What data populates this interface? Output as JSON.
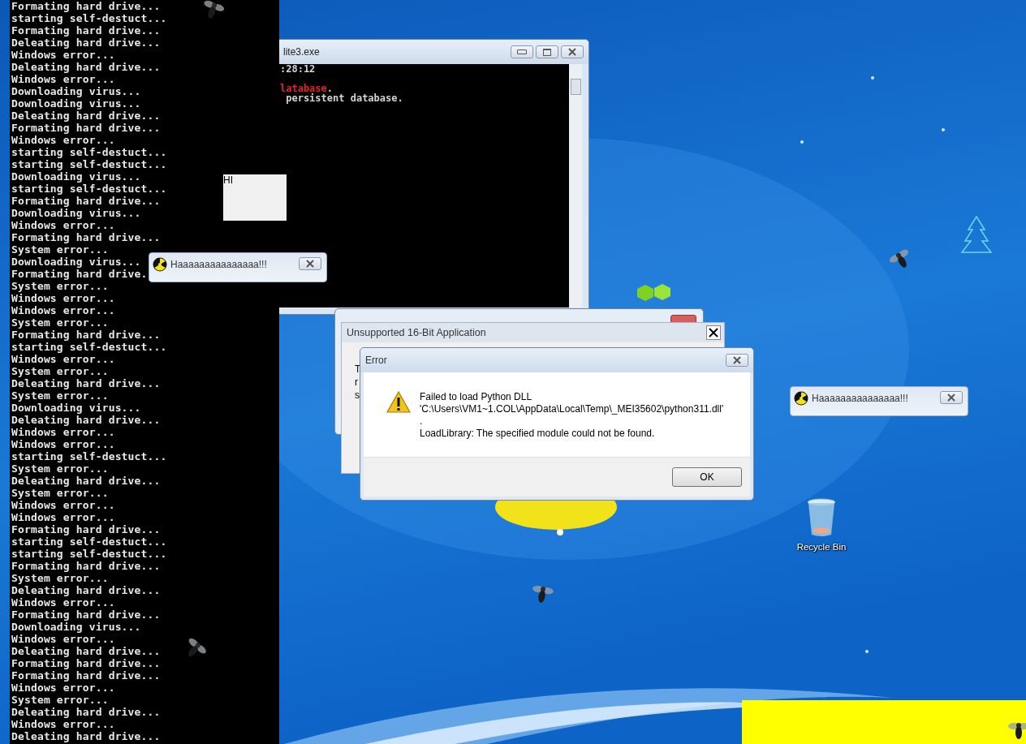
{
  "terminal": {
    "lines": [
      "Formating hard drive...",
      "starting self-destuct...",
      "Formating hard drive...",
      "Deleating hard drive...",
      "Windows error...",
      "Deleating hard drive...",
      "Windows error...",
      "Downloading virus...",
      "Downloading virus...",
      "Deleating hard drive...",
      "Formating hard drive...",
      "Windows error...",
      "starting self-destuct...",
      "starting self-destuct...",
      "Downloading virus...",
      "starting self-destuct...",
      "Formating hard drive...",
      "Downloading virus...",
      "Windows error...",
      "Formating hard drive...",
      "System error...",
      "Downloading virus...",
      "Formating hard drive.",
      "System error...",
      "Windows error...",
      "Windows error...",
      "System error...",
      "Formating hard drive...",
      "starting self-destuct...",
      "Windows error...",
      "System error...",
      "Deleating hard drive...",
      "System error...",
      "Downloading virus...",
      "Deleating hard drive...",
      "Windows error...",
      "Windows error...",
      "starting self-destuct...",
      "System error...",
      "Deleating hard drive...",
      "System error...",
      "Windows error...",
      "Windows error...",
      "Formating hard drive...",
      "starting self-destuct...",
      "starting self-destuct...",
      "Formating hard drive...",
      "System error...",
      "Deleating hard drive...",
      "Windows error...",
      "Formating hard drive...",
      "Downloading virus...",
      "Windows error...",
      "Deleating hard drive...",
      "Formating hard drive...",
      "Formating hard drive...",
      "Windows error...",
      "System error...",
      "Deleating hard drive...",
      "Windows error...",
      "Deleating hard drive..."
    ]
  },
  "console_window": {
    "title": "lite3.exe",
    "lines": [
      {
        "segments": [
          {
            "text": ":28:12",
            "highlighted": false
          }
        ]
      },
      {
        "segments": [
          {
            "text": "latabase",
            "highlighted": true
          },
          {
            "text": ".",
            "highlighted": false
          }
        ]
      },
      {
        "segments": [
          {
            "text": " persistent database.",
            "highlighted": false
          }
        ]
      }
    ]
  },
  "unsupported_dialog": {
    "title": "Unsupported 16-Bit Application",
    "fragments": [
      "T",
      "r",
      "s"
    ]
  },
  "error_dialog": {
    "title": "Error",
    "message": [
      "Failed to load Python DLL",
      "'C:\\Users\\VM1~1.COL\\AppData\\Local\\Temp\\_MEI35602\\python311.dll'",
      ".",
      "LoadLibrary: The specified module could not be found."
    ],
    "button": "OK"
  },
  "note_box": {
    "text": "HI"
  },
  "popups": [
    {
      "title": "Haaaaaaaaaaaaaaa!!!"
    },
    {
      "title": "Haaaaaaaaaaaaaaa!!!"
    }
  ],
  "desktop": {
    "icons": [
      {
        "label": "Recycle Bin"
      }
    ]
  }
}
